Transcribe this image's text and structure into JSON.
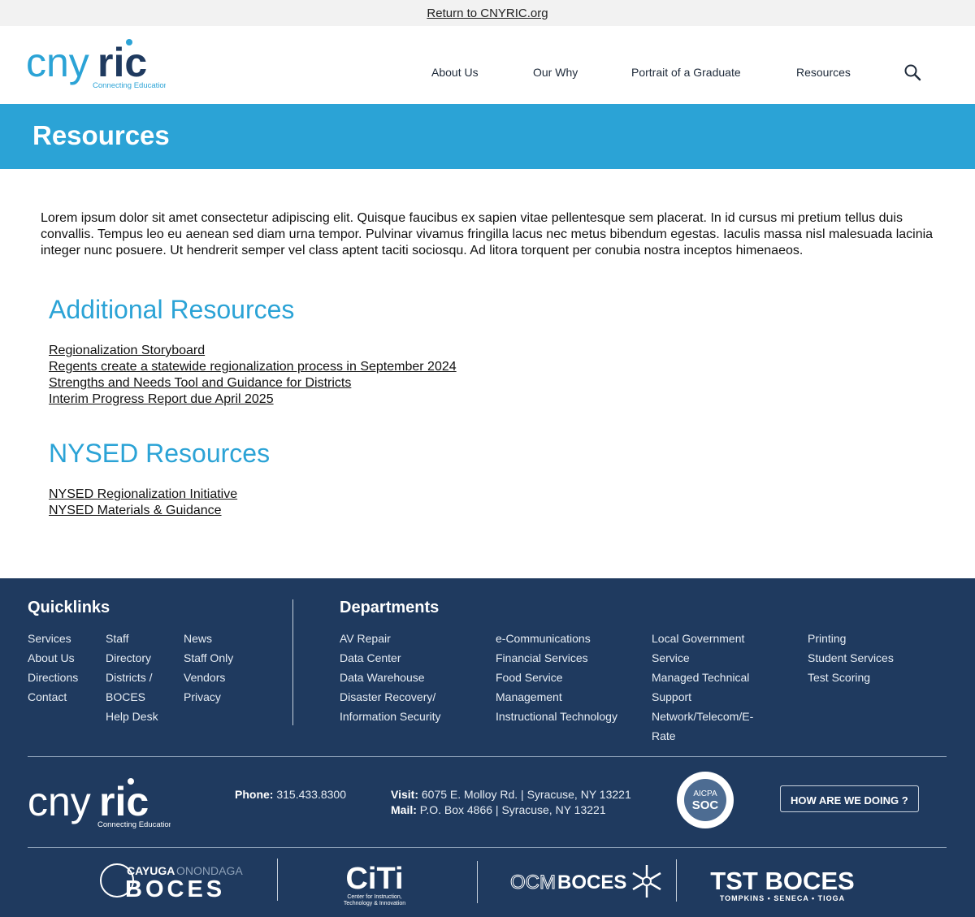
{
  "topbar": {
    "return_link": "Return to CNYRIC.org"
  },
  "header": {
    "logo_text": "cnyric",
    "logo_tagline": "Connecting Education",
    "nav": [
      "About Us",
      "Our Why",
      "Portrait of a Graduate",
      "Resources"
    ]
  },
  "hero": {
    "title": "Resources"
  },
  "main": {
    "intro": "Lorem ipsum dolor sit amet consectetur adipiscing elit. Quisque faucibus ex sapien vitae pellentesque sem placerat. In id cursus mi pretium tellus duis convallis. Tempus leo eu aenean sed diam urna tempor. Pulvinar vivamus fringilla lacus nec metus bibendum egestas. Iaculis massa nisl malesuada lacinia integer nunc posuere. Ut hendrerit semper vel class aptent taciti sociosqu. Ad litora torquent per conubia nostra inceptos himenaeos.",
    "additional": {
      "title": "Additional Resources",
      "links": [
        "Regionalization Storyboard",
        "Regents create a statewide regionalization process in September 2024",
        "Strengths and Needs Tool and Guidance for Districts",
        "Interim Progress Report due April 2025"
      ]
    },
    "nysed": {
      "title": "NYSED Resources",
      "links": [
        "NYSED Regionalization Initiative",
        "NYSED Materials & Guidance"
      ]
    }
  },
  "footer": {
    "quicklinks_title": "Quicklinks",
    "quicklinks": [
      [
        "Services",
        "About Us",
        "Directions",
        "Contact"
      ],
      [
        "Staff",
        "Directory",
        "Districts /",
        "BOCES",
        "Help Desk"
      ],
      [
        "News",
        "Staff Only",
        "Vendors",
        "Privacy"
      ]
    ],
    "departments_title": "Departments",
    "departments": [
      [
        "AV Repair",
        "Data Center",
        "Data Warehouse",
        "Disaster Recovery/",
        "Information Security"
      ],
      [
        "e-Communications",
        "Financial Services",
        "Food Service",
        "Management",
        "Instructional Technology"
      ],
      [
        "Local Government",
        "Service",
        "Managed Technical",
        "Support",
        "Network/Telecom/E-",
        "Rate"
      ],
      [
        "Printing",
        "Student Services",
        "Test Scoring"
      ]
    ],
    "phone_label": "Phone:",
    "phone": "315.433.8300",
    "visit_label": "Visit:",
    "visit": "6075 E. Molloy Rd. | Syracuse, NY 13221",
    "mail_label": "Mail:",
    "mail": "P.O. Box 4866 | Syracuse, NY 13221",
    "soc_badge_top": "AICPA",
    "soc_badge_mid": "SOC",
    "how_button": "HOW ARE WE DOING ?",
    "partners": {
      "cayuga_top_a": "CAYUGA",
      "cayuga_top_b": "ONONDAGA",
      "cayuga_main": "BOCES",
      "citi_main": "CiTi",
      "citi_sub1": "Center for Instruction,",
      "citi_sub2": "Technology & Innovation",
      "ocm_a": "OCM",
      "ocm_b": "BOCES",
      "tst_main": "TST BOCES",
      "tst_sub": "TOMPKINS • SENECA • TIOGA"
    }
  },
  "colors": {
    "brand_blue": "#2ba3d6",
    "footer_navy": "#1f3a5f"
  }
}
